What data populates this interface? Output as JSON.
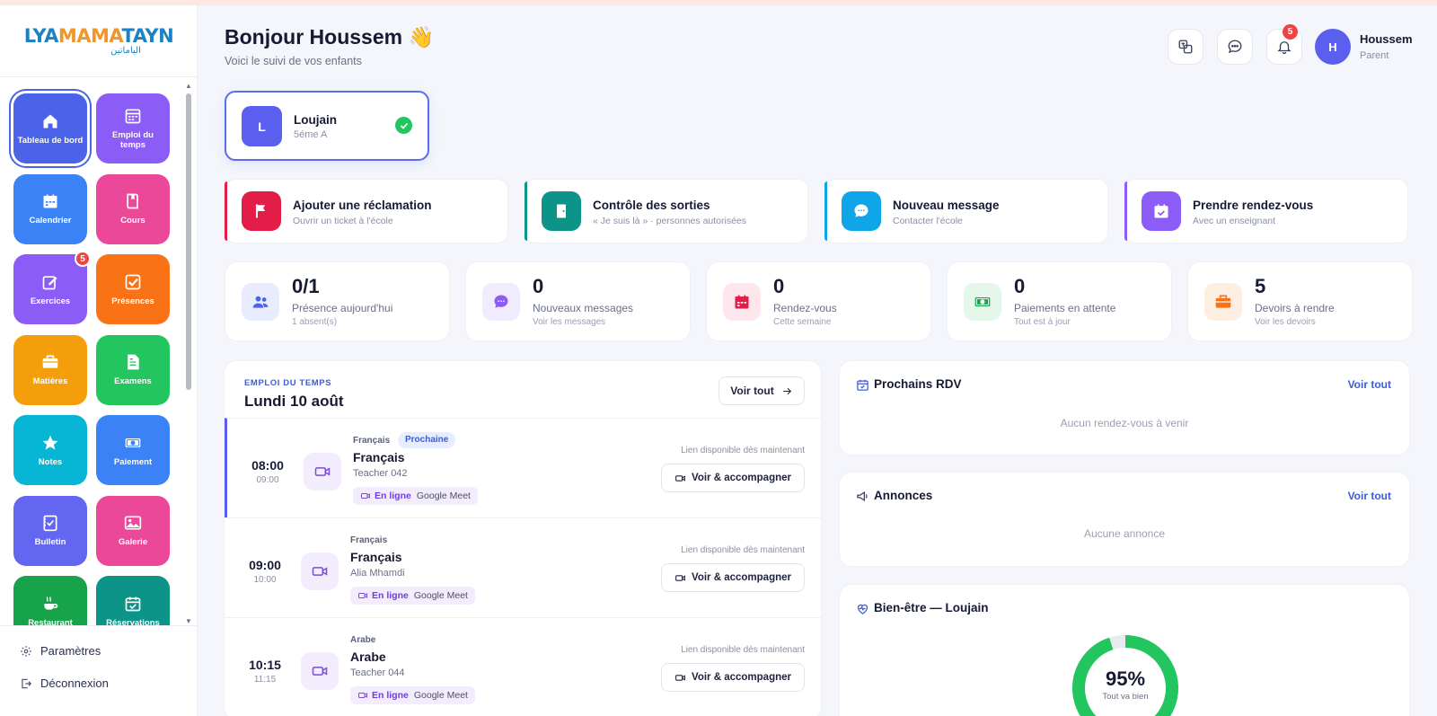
{
  "logo": {
    "part1": "LYA",
    "part2": "MAMA",
    "part3": "TAYN",
    "tagline": "الياماتين"
  },
  "sidebar": {
    "items": [
      {
        "label": "Tableau de bord",
        "color": "#4b63e8",
        "icon": "home-icon"
      },
      {
        "label": "Emploi du temps",
        "color": "#8b5cf6",
        "icon": "timetable-icon"
      },
      {
        "label": "Calendrier",
        "color": "#3b82f6",
        "icon": "calendar-icon"
      },
      {
        "label": "Cours",
        "color": "#ec4899",
        "icon": "book-icon"
      },
      {
        "label": "Exercices",
        "color": "#8b5cf6",
        "icon": "edit-icon",
        "badge": "5"
      },
      {
        "label": "Présences",
        "color": "#f97316",
        "icon": "check-square-icon"
      },
      {
        "label": "Matières",
        "color": "#f59e0b",
        "icon": "briefcase-icon"
      },
      {
        "label": "Examens",
        "color": "#22c55e",
        "icon": "file-icon"
      },
      {
        "label": "Notes",
        "color": "#06b6d4",
        "icon": "star-icon"
      },
      {
        "label": "Paiement",
        "color": "#3b82f6",
        "icon": "money-icon"
      },
      {
        "label": "Bulletin",
        "color": "#6366f1",
        "icon": "report-icon"
      },
      {
        "label": "Galerie",
        "color": "#ec4899",
        "icon": "gallery-icon"
      },
      {
        "label": "Restaurant",
        "color": "#16a34a",
        "icon": "cup-icon"
      },
      {
        "label": "Réservations",
        "color": "#0d9488",
        "icon": "reservation-icon"
      }
    ],
    "settings_label": "Paramètres",
    "logout_label": "Déconnexion"
  },
  "header": {
    "greeting": "Bonjour Houssem 👋",
    "subtitle": "Voici le suivi de vos enfants",
    "notification_count": "5",
    "user_initial": "H",
    "user_name": "Houssem",
    "user_role": "Parent"
  },
  "child": {
    "initial": "L",
    "name": "Loujain",
    "class": "5éme A"
  },
  "actions": [
    {
      "title": "Ajouter une réclamation",
      "subtitle": "Ouvrir un ticket à l'école",
      "color": "#e11d48",
      "icon": "flag-icon"
    },
    {
      "title": "Contrôle des sorties",
      "subtitle": "« Je suis là » · personnes autorisées",
      "color": "#0d9488",
      "icon": "door-icon"
    },
    {
      "title": "Nouveau message",
      "subtitle": "Contacter l'école",
      "color": "#0ea5e9",
      "icon": "chat-icon"
    },
    {
      "title": "Prendre rendez-vous",
      "subtitle": "Avec un enseignant",
      "color": "#8b5cf6",
      "icon": "calendar-check-icon"
    }
  ],
  "stats": [
    {
      "value": "0/1",
      "label": "Présence aujourd'hui",
      "sub": "1 absent(s)",
      "color": "#4b63e8",
      "bg": "#e8ecfd",
      "icon": "users-icon"
    },
    {
      "value": "0",
      "label": "Nouveaux messages",
      "sub": "Voir les messages",
      "color": "#8b5cf6",
      "bg": "#f1ebfe",
      "icon": "message-icon"
    },
    {
      "value": "0",
      "label": "Rendez-vous",
      "sub": "Cette semaine",
      "color": "#e11d48",
      "bg": "#fde7ec",
      "icon": "calendar-icon"
    },
    {
      "value": "0",
      "label": "Paiements en attente",
      "sub": "Tout est à jour",
      "color": "#16a34a",
      "bg": "#e4f7ea",
      "icon": "money-icon"
    },
    {
      "value": "5",
      "label": "Devoirs à rendre",
      "sub": "Voir les devoirs",
      "color": "#f97316",
      "bg": "#fdeee2",
      "icon": "briefcase-icon"
    }
  ],
  "schedule": {
    "kicker": "EMPLOI DU TEMPS",
    "title": "Lundi 10 août",
    "view_all": "Voir tout",
    "rows": [
      {
        "start": "08:00",
        "end": "09:00",
        "subject_small": "Français",
        "tag": "Prochaine",
        "subject": "Français",
        "teacher": "Teacher 042",
        "mode": "En ligne",
        "platform": "Google Meet",
        "availability": "Lien disponible dès maintenant",
        "button": "Voir & accompagner"
      },
      {
        "start": "09:00",
        "end": "10:00",
        "subject_small": "Français",
        "tag": "",
        "subject": "Français",
        "teacher": "Alia Mhamdi",
        "mode": "En ligne",
        "platform": "Google Meet",
        "availability": "Lien disponible dès maintenant",
        "button": "Voir & accompagner"
      },
      {
        "start": "10:15",
        "end": "11:15",
        "subject_small": "Arabe",
        "tag": "",
        "subject": "Arabe",
        "teacher": "Teacher 044",
        "mode": "En ligne",
        "platform": "Google Meet",
        "availability": "Lien disponible dès maintenant",
        "button": "Voir & accompagner"
      }
    ]
  },
  "rdv": {
    "title": "Prochains RDV",
    "link": "Voir tout",
    "empty": "Aucun rendez-vous à venir"
  },
  "annonces": {
    "title": "Annonces",
    "link": "Voir tout",
    "empty": "Aucune annonce"
  },
  "wellbeing": {
    "title": "Bien-être — Loujain",
    "percent": 95,
    "value": "95%",
    "label": "Tout va bien",
    "color": "#22c55e"
  }
}
